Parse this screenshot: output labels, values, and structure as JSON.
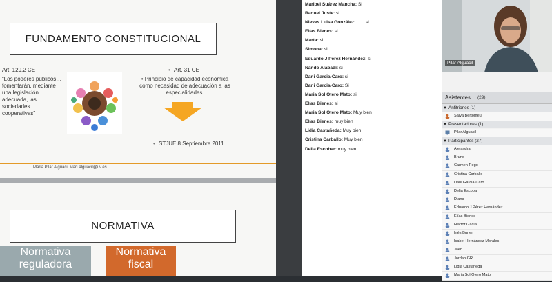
{
  "slide1": {
    "title": "FUNDAMENTO CONSTITUCIONAL",
    "art_129": "Art. 129.2 CE",
    "quote": "“Los poderes públicos…fomentarán, mediante una legislación adecuada, las sociedades cooperativas”",
    "art_31_bullet": "•",
    "art_31": "Art. 31 CE",
    "principio": "• Principio de capacidad económica como necesidad de adecuación a las especialidades.",
    "stjue_bullet": "•",
    "stjue": "STJUE 8 Septiembre 2011",
    "footer": "Maria Pilar Alguacil Marí alguacil@uv.es"
  },
  "slide2": {
    "title": "NORMATIVA",
    "box_reguladora": "Normativa reguladora",
    "box_fiscal": "Normativa fiscal"
  },
  "chat": [
    {
      "name": "Maribel Suárez Mancha:",
      "msg": " Si"
    },
    {
      "name": "Raquel Juste:",
      "msg": " si"
    },
    {
      "name": "Nieves Luisa González:",
      "msg": "        si"
    },
    {
      "name": "Elías Bienes:",
      "msg": " si"
    },
    {
      "name": "Marta:",
      "msg": " si"
    },
    {
      "name": "Simona:",
      "msg": " si"
    },
    {
      "name": "Eduardo J Pérez Hernández:",
      "msg": " si"
    },
    {
      "name": "Nando Alabadí:",
      "msg": " si"
    },
    {
      "name": "Dani Garcia-Caro:",
      "msg": " si"
    },
    {
      "name": "Dani Garcia-Caro:",
      "msg": " Si"
    },
    {
      "name": "Maria Sol Otero Mato:",
      "msg": " si"
    },
    {
      "name": "Elías Bienes:",
      "msg": " si"
    },
    {
      "name": "Maria Sol Otero Mato:",
      "msg": " Muy bien"
    },
    {
      "name": "Elías Bienes:",
      "msg": " muy bien"
    },
    {
      "name": "Lidia Castañeda:",
      "msg": " Muy bien"
    },
    {
      "name": "Cristina Carballo:",
      "msg": " Muy bien"
    },
    {
      "name": "Delia Escobar:",
      "msg": " muy bien"
    }
  ],
  "video": {
    "name": "Pilar Alguacil"
  },
  "attendees": {
    "title": "Asistentes",
    "count": "(29)",
    "hosts": {
      "label": "Anfitriones (1)",
      "people": [
        "Salva Bertomeu"
      ]
    },
    "presenters": {
      "label": "Presentadores (1)",
      "people": [
        "Pilar Alguacil"
      ]
    },
    "participants": {
      "label": "Participantes (27)",
      "people": [
        "Alejandra",
        "Bruno",
        "Carmen Rego",
        "Cristina Carballo",
        "Dani Garcia-Caro",
        "Delia Escobar",
        "Diana",
        "Eduardo J Pérez Hernández",
        "Elías Bienes",
        "Héctor Gacía",
        "Inés Buneri",
        "Isabel Hernández Morales",
        "Jaeh",
        "Jordan GR",
        "Lidia Castañeda",
        "Maria Sol Otero Mato"
      ]
    }
  }
}
